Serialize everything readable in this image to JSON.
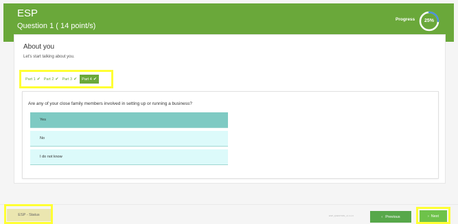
{
  "header": {
    "title": "ESP",
    "subtitle": "Question 1 ( 14 point/s)",
    "progress_label": "Progress",
    "progress_text": "25%",
    "progress_value": 0.25
  },
  "card": {
    "title": "About you",
    "subtitle": "Let's start talking about you."
  },
  "parts": [
    {
      "label": "Part 1",
      "check": "✔",
      "active": false
    },
    {
      "label": "Part 2",
      "check": "✔",
      "active": false
    },
    {
      "label": "Part 3",
      "check": "✔",
      "active": false
    },
    {
      "label": "Part 4",
      "check": "✔",
      "active": true
    }
  ],
  "question": {
    "text": "Are any of your close family members involved in setting up or running a business?",
    "options": [
      {
        "label": "Yes",
        "selected": true
      },
      {
        "label": "No",
        "selected": false
      },
      {
        "label": "I do not know",
        "selected": false
      }
    ]
  },
  "footer": {
    "status_label": "ESP - Status",
    "small_text": "ESP_QUESTION_v1.4.1.0",
    "previous_label": "Previous",
    "previous_icon": "‹",
    "next_label": "Next",
    "next_icon": "›"
  },
  "colors": {
    "brand_green": "#6aa83a",
    "selected_option": "#7ecac3",
    "option_bg": "#dcfafa",
    "highlight": "#ffff33"
  }
}
